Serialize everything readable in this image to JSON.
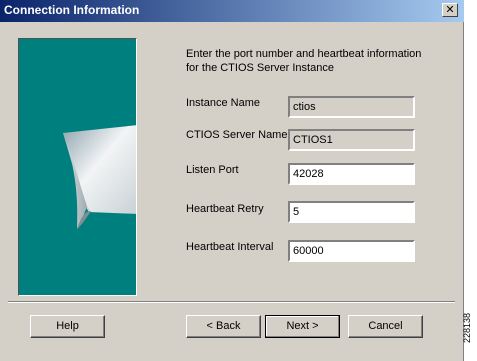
{
  "window": {
    "title": "Connection Information",
    "close_glyph": "✕"
  },
  "intro": "Enter the port number and heartbeat information for the CTIOS Server Instance",
  "fields": {
    "instance_name": {
      "label": "Instance Name",
      "value": "ctios"
    },
    "server_name": {
      "label": "CTIOS Server Name",
      "value": "CTIOS1"
    },
    "listen_port": {
      "label": "Listen Port",
      "value": "42028"
    },
    "heartbeat_retry": {
      "label": "Heartbeat Retry",
      "value": "5"
    },
    "heartbeat_interval": {
      "label": "Heartbeat Interval",
      "value": "60000"
    }
  },
  "buttons": {
    "help": "Help",
    "back": "< Back",
    "next": "Next >",
    "cancel": "Cancel"
  },
  "image_id": "228138",
  "colors": {
    "title_start": "#0a246a",
    "title_end": "#a6caf0",
    "art_teal": "#007f7f",
    "dialog_bg": "#d4d0c8"
  }
}
